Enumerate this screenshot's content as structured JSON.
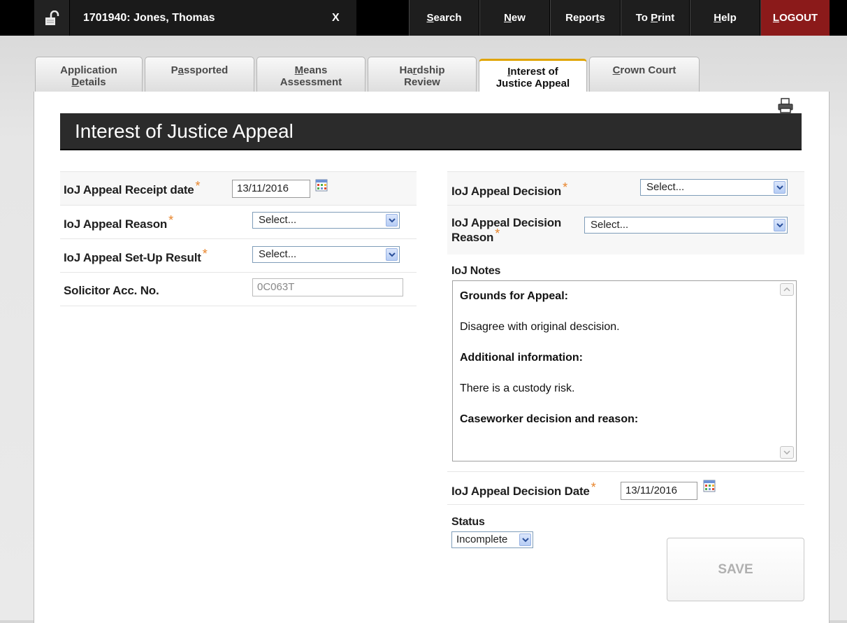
{
  "topbar": {
    "record": "1701940:  Jones, Thomas",
    "close": "X",
    "nav": [
      {
        "label": "Search",
        "key": "S"
      },
      {
        "label": "New",
        "key": "N"
      },
      {
        "label": "Reports",
        "key": "t"
      },
      {
        "label": "To Print",
        "key": "P"
      },
      {
        "label": "Help",
        "key": "H"
      },
      {
        "label": "LOGOUT",
        "key": "L"
      }
    ]
  },
  "tabs": [
    {
      "line1": "Application",
      "line2": "Details"
    },
    {
      "line1": "Passported",
      "line2": ""
    },
    {
      "line1": "Means",
      "line2": "Assessment"
    },
    {
      "line1": "Hardship",
      "line2": "Review"
    },
    {
      "line1": "Interest of",
      "line2": "Justice Appeal"
    },
    {
      "line1": "Crown Court",
      "line2": ""
    }
  ],
  "page_title": "Interest of Justice Appeal",
  "left": {
    "receipt_label": "IoJ Appeal Receipt date",
    "receipt_value": "13/11/2016",
    "reason_label": "IoJ Appeal Reason",
    "reason_value": "Select...",
    "setup_label": "IoJ Appeal Set-Up Result",
    "setup_value": "Select...",
    "solicitor_label": "Solicitor Acc. No.",
    "solicitor_value": "0C063T"
  },
  "right": {
    "decision_label": "IoJ Appeal Decision",
    "decision_value": "Select...",
    "decision_reason_label_1": "IoJ Appeal Decision",
    "decision_reason_label_2": "Reason",
    "decision_reason_value": "Select...",
    "notes_label": "IoJ Notes",
    "notes": {
      "h1": "Grounds for Appeal:",
      "t1": "Disagree with original descision.",
      "h2": "Additional information:",
      "t2": "There is a custody risk.",
      "h3": "Caseworker decision and reason:"
    },
    "decision_date_label": "IoJ Appeal Decision Date",
    "decision_date_value": "13/11/2016",
    "status_label": "Status",
    "status_value": "Incomplete"
  },
  "required_mark": "*",
  "save_label": "SAVE",
  "colors": {
    "accent": "#e0a400",
    "logout": "#8b1a1a",
    "required": "#e8842a"
  }
}
